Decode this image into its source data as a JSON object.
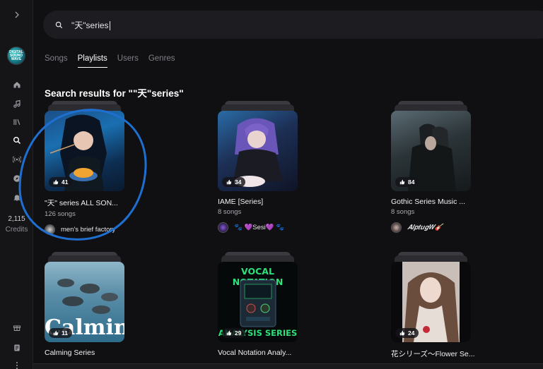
{
  "sidebar": {
    "logo_text": "DIGITAL SOUND WAVE",
    "items": [
      {
        "icon": "chevron-right-icon"
      },
      {
        "icon": "home-icon"
      },
      {
        "icon": "music-note-icon"
      },
      {
        "icon": "library-icon"
      },
      {
        "icon": "search-icon"
      },
      {
        "icon": "radio-icon"
      },
      {
        "icon": "compass-icon"
      },
      {
        "icon": "bell-icon"
      },
      {
        "icon": "gift-icon"
      },
      {
        "icon": "document-icon"
      },
      {
        "icon": "more-icon"
      }
    ],
    "credits_value": "2,115",
    "credits_label": "Credits"
  },
  "search": {
    "value": "\"天\"series"
  },
  "tabs": [
    {
      "label": "Songs",
      "active": false
    },
    {
      "label": "Playlists",
      "active": true
    },
    {
      "label": "Users",
      "active": false
    },
    {
      "label": "Genres",
      "active": false
    }
  ],
  "results_title": "Search results for \"\"天\"series\"",
  "cards": [
    {
      "title": "\"天\" series ALL SON...",
      "songs": "126 songs",
      "likes": "41",
      "author": "men's brief factory"
    },
    {
      "title": "IAME [Series]",
      "songs": "8 songs",
      "likes": "34",
      "author": "🐾 💜Sesi💜 🐾"
    },
    {
      "title": "Gothic Series Music ...",
      "songs": "8 songs",
      "likes": "84",
      "author": "𝑨𝒍𝒑𝒕𝒖𝒈𝑾🎸"
    },
    {
      "title": "Calming Series",
      "songs": "",
      "likes": "11",
      "author": "",
      "cover_text": "Calming"
    },
    {
      "title": "Vocal Notation Analy...",
      "songs": "",
      "likes": "29",
      "author": "",
      "cover_text_top": "VOCAL NOTATION",
      "cover_text_bottom": "ANALYSIS SERIES"
    },
    {
      "title": "花シリーズ〜Flower Se...",
      "songs": "",
      "likes": "24",
      "author": ""
    }
  ],
  "colors": {
    "background": "#101012",
    "sidebar": "#151517",
    "annotation": "#1f6fd1",
    "vocal_green": "#2ee07a"
  }
}
